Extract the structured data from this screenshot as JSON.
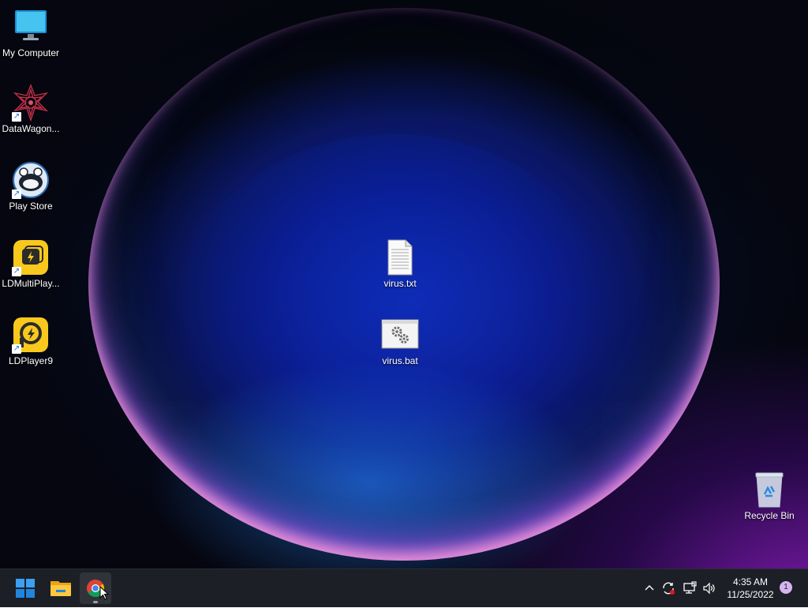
{
  "desktop": {
    "icons": [
      {
        "label": "My Computer",
        "icon": "monitor-icon",
        "shortcut": false
      },
      {
        "label": "DataWagon...",
        "icon": "datawagon-icon",
        "shortcut": true
      },
      {
        "label": "Play Store",
        "icon": "play-store-icon",
        "shortcut": true
      },
      {
        "label": "LDMultiPlay...",
        "icon": "ldmultiplayer-icon",
        "shortcut": true
      },
      {
        "label": "LDPlayer9",
        "icon": "ldplayer-icon",
        "shortcut": true
      }
    ],
    "files": [
      {
        "label": "virus.txt",
        "icon": "text-file-icon"
      },
      {
        "label": "virus.bat",
        "icon": "batch-file-icon"
      }
    ],
    "recycle_bin": {
      "label": "Recycle Bin",
      "icon": "recycle-bin-icon"
    }
  },
  "taskbar": {
    "pinned": [
      {
        "name": "start",
        "icon": "windows-start-icon"
      },
      {
        "name": "file-explorer",
        "icon": "folder-icon"
      },
      {
        "name": "chrome",
        "icon": "chrome-icon",
        "active": true
      }
    ],
    "tray": {
      "icons": [
        "chevron-up-icon",
        "sync-icon",
        "network-icon",
        "speaker-icon"
      ],
      "time": "4:35 AM",
      "date": "11/25/2022",
      "notification_count": "1"
    }
  },
  "colors": {
    "taskbar": "#1c1f26",
    "accent": "#0078d4",
    "ld_yellow": "#f8c91c"
  }
}
